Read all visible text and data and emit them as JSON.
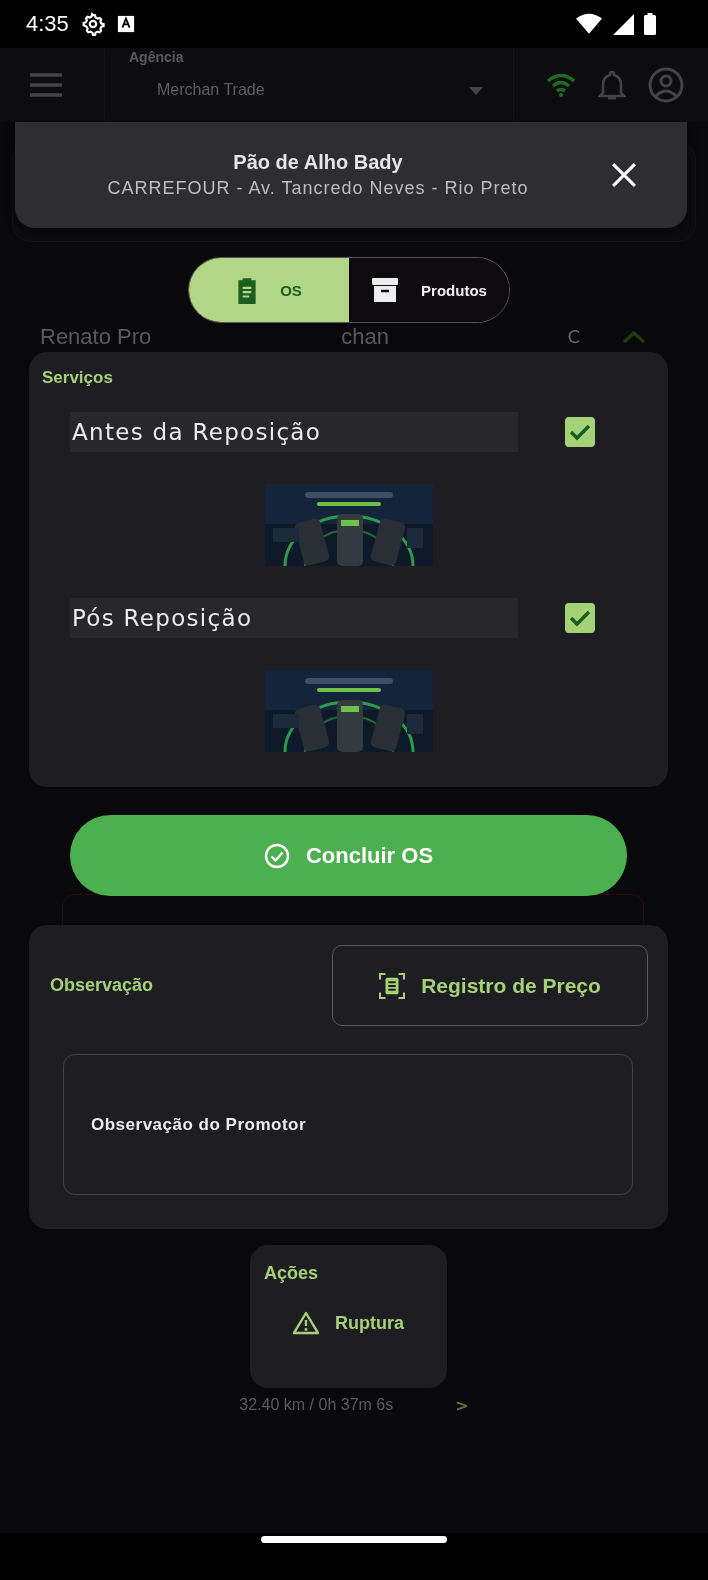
{
  "status_bar": {
    "time": "4:35"
  },
  "app_bar": {
    "agency_label": "Agência",
    "agency_value": "Merchan Trade"
  },
  "header": {
    "title": "Pão de Alho Bady",
    "subtitle": "CARREFOUR - Av. Tancredo Neves - Rio Preto"
  },
  "tabs": [
    {
      "label": "OS",
      "selected": true
    },
    {
      "label": "Produtos",
      "selected": false
    }
  ],
  "background": {
    "promoter_name_start": "Renato Pro",
    "promoter_name_end": "chan",
    "column_3": "C",
    "distance": "32.40 km / 0h 37m 6s",
    "next": ">"
  },
  "services": {
    "title": "Serviços",
    "items": [
      {
        "label": "Antes da Reposição",
        "checked": true
      },
      {
        "label": "Pós Reposição",
        "checked": true
      }
    ]
  },
  "complete_button": "Concluir OS",
  "observation": {
    "title": "Observação",
    "price_button": "Registro de Preço",
    "field_label": "Observação do Promotor"
  },
  "actions": {
    "title": "Ações",
    "items": [
      {
        "label": "Ruptura"
      }
    ]
  }
}
